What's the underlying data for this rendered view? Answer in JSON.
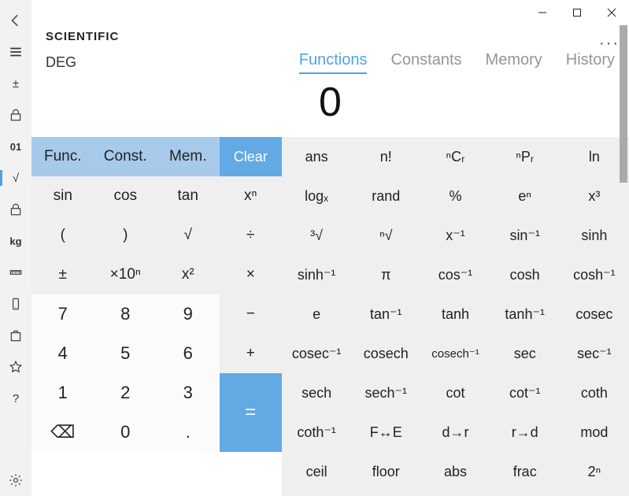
{
  "sidebar": {
    "items": [
      {
        "name": "back",
        "glyph": "back"
      },
      {
        "name": "menu",
        "glyph": "menu"
      },
      {
        "name": "plusminus",
        "label": "±"
      },
      {
        "name": "lock",
        "glyph": "lock"
      },
      {
        "name": "binary",
        "label": "01"
      },
      {
        "name": "root",
        "label": "√",
        "selected": true
      },
      {
        "name": "lock2",
        "glyph": "lock"
      },
      {
        "name": "weight",
        "label": "kg"
      },
      {
        "name": "ruler",
        "glyph": "ruler"
      },
      {
        "name": "phone",
        "glyph": "phone"
      },
      {
        "name": "bag",
        "glyph": "bag"
      },
      {
        "name": "star",
        "glyph": "star"
      },
      {
        "name": "help",
        "label": "?"
      }
    ],
    "settings": "gear"
  },
  "titlebar": {
    "min": "min",
    "max": "max",
    "close": "close",
    "more": "···"
  },
  "header": {
    "mode": "SCIENTIFIC",
    "deg": "DEG",
    "tabs": [
      {
        "label": "Functions",
        "active": true
      },
      {
        "label": "Constants",
        "active": false
      },
      {
        "label": "Memory",
        "active": false
      },
      {
        "label": "History",
        "active": false
      }
    ]
  },
  "display": "0",
  "leftpad": {
    "top": [
      {
        "label": "Func."
      },
      {
        "label": "Const."
      },
      {
        "label": "Mem."
      },
      {
        "label": "Clear",
        "clear": true
      }
    ],
    "ops1": [
      {
        "label": "sin"
      },
      {
        "label": "cos"
      },
      {
        "label": "tan"
      },
      {
        "label": "xⁿ"
      }
    ],
    "ops2": [
      {
        "label": "("
      },
      {
        "label": ")"
      },
      {
        "label": "√"
      },
      {
        "label": "÷"
      }
    ],
    "ops3": [
      {
        "label": "±"
      },
      {
        "label": "×10ⁿ"
      },
      {
        "label": "x²"
      },
      {
        "label": "×"
      }
    ],
    "num_rows": [
      [
        "7",
        "8",
        "9",
        "−"
      ],
      [
        "4",
        "5",
        "6",
        "+"
      ],
      [
        "1",
        "2",
        "3",
        "="
      ],
      [
        "⌫",
        "0",
        ".",
        ""
      ]
    ]
  },
  "rightpad": {
    "rows": [
      [
        "ans",
        "n!",
        "ⁿCᵣ",
        "ⁿPᵣ",
        "ln"
      ],
      [
        "logₓ",
        "rand",
        "%",
        "eⁿ",
        "x³"
      ],
      [
        "³√",
        "ⁿ√",
        "x⁻¹",
        "sin⁻¹",
        "sinh"
      ],
      [
        "sinh⁻¹",
        "π",
        "cos⁻¹",
        "cosh",
        "cosh⁻¹"
      ],
      [
        "e",
        "tan⁻¹",
        "tanh",
        "tanh⁻¹",
        "cosec"
      ],
      [
        "cosec⁻¹",
        "cosech",
        "cosech⁻¹",
        "sec",
        "sec⁻¹"
      ],
      [
        "sech",
        "sech⁻¹",
        "cot",
        "cot⁻¹",
        "coth"
      ],
      [
        "coth⁻¹",
        "F↔E",
        "d→r",
        "r→d",
        "mod"
      ],
      [
        "ceil",
        "floor",
        "abs",
        "frac",
        "2ⁿ"
      ]
    ]
  }
}
